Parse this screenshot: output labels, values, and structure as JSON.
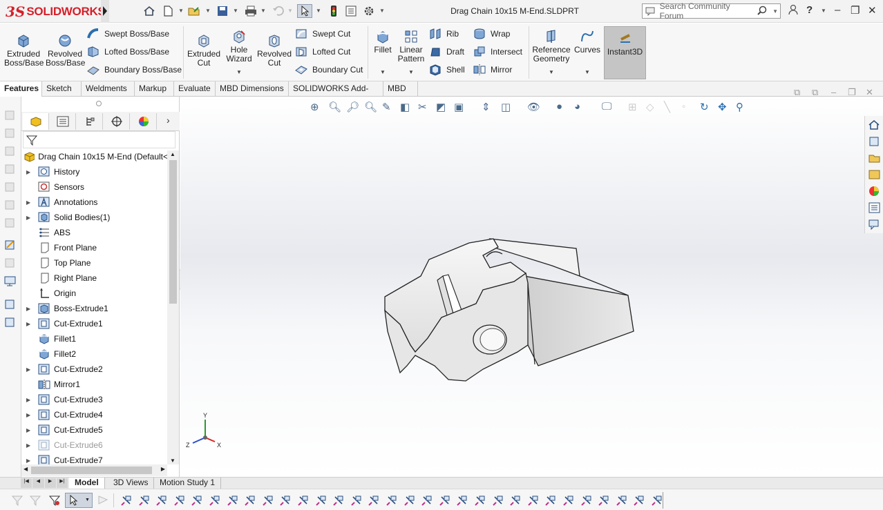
{
  "app": {
    "logo_ds": "3S",
    "logo_text": "SOLIDWORKS",
    "document_title": "Drag Chain 10x15 M-End.SLDPRT"
  },
  "search": {
    "placeholder": "Search Community Forum"
  },
  "ribbon": {
    "extruded_boss": "Extruded\nBoss/Base",
    "revolved_boss": "Revolved\nBoss/Base",
    "swept_boss": "Swept Boss/Base",
    "lofted_boss": "Lofted Boss/Base",
    "boundary_boss": "Boundary Boss/Base",
    "extruded_cut": "Extruded\nCut",
    "hole_wizard": "Hole\nWizard",
    "revolved_cut": "Revolved\nCut",
    "swept_cut": "Swept Cut",
    "lofted_cut": "Lofted Cut",
    "boundary_cut": "Boundary Cut",
    "fillet": "Fillet",
    "linear_pattern": "Linear\nPattern",
    "rib": "Rib",
    "draft": "Draft",
    "shell": "Shell",
    "wrap": "Wrap",
    "intersect": "Intersect",
    "mirror": "Mirror",
    "reference_geometry": "Reference\nGeometry",
    "curves": "Curves",
    "instant3d": "Instant3D"
  },
  "tabs": [
    "Features",
    "Sketch",
    "Weldments",
    "Markup",
    "Evaluate",
    "MBD Dimensions",
    "SOLIDWORKS Add-Ins",
    "MBD"
  ],
  "tree": {
    "root": "Drag Chain 10x15 M-End  (Default<",
    "items": [
      {
        "label": "History",
        "expandable": true,
        "icon": "history-icon"
      },
      {
        "label": "Sensors",
        "expandable": false,
        "icon": "sensor-icon"
      },
      {
        "label": "Annotations",
        "expandable": true,
        "icon": "annotations-icon"
      },
      {
        "label": "Solid Bodies(1)",
        "expandable": true,
        "icon": "solid-bodies-icon"
      },
      {
        "label": "ABS",
        "expandable": false,
        "icon": "material-icon"
      },
      {
        "label": "Front Plane",
        "expandable": false,
        "icon": "plane-icon"
      },
      {
        "label": "Top Plane",
        "expandable": false,
        "icon": "plane-icon"
      },
      {
        "label": "Right Plane",
        "expandable": false,
        "icon": "plane-icon"
      },
      {
        "label": "Origin",
        "expandable": false,
        "icon": "origin-icon"
      },
      {
        "label": "Boss-Extrude1",
        "expandable": true,
        "icon": "boss-extrude-icon"
      },
      {
        "label": "Cut-Extrude1",
        "expandable": true,
        "icon": "cut-extrude-icon"
      },
      {
        "label": "Fillet1",
        "expandable": false,
        "icon": "fillet-icon"
      },
      {
        "label": "Fillet2",
        "expandable": false,
        "icon": "fillet-icon"
      },
      {
        "label": "Cut-Extrude2",
        "expandable": true,
        "icon": "cut-extrude-icon"
      },
      {
        "label": "Mirror1",
        "expandable": false,
        "icon": "mirror-icon"
      },
      {
        "label": "Cut-Extrude3",
        "expandable": true,
        "icon": "cut-extrude-icon"
      },
      {
        "label": "Cut-Extrude4",
        "expandable": true,
        "icon": "cut-extrude-icon"
      },
      {
        "label": "Cut-Extrude5",
        "expandable": true,
        "icon": "cut-extrude-icon"
      },
      {
        "label": "Cut-Extrude6",
        "expandable": true,
        "icon": "cut-extrude-icon",
        "dim": true
      },
      {
        "label": "Cut-Extrude7",
        "expandable": true,
        "icon": "cut-extrude-icon"
      }
    ]
  },
  "bottom_tabs": [
    "Model",
    "3D Views",
    "Motion Study 1"
  ],
  "triad": {
    "x": "X",
    "y": "Y",
    "z": "Z"
  },
  "colors": {
    "accent_red": "#d5202a",
    "ribbon_bg": "#f7f7f7",
    "selected": "#c5c5c5"
  }
}
